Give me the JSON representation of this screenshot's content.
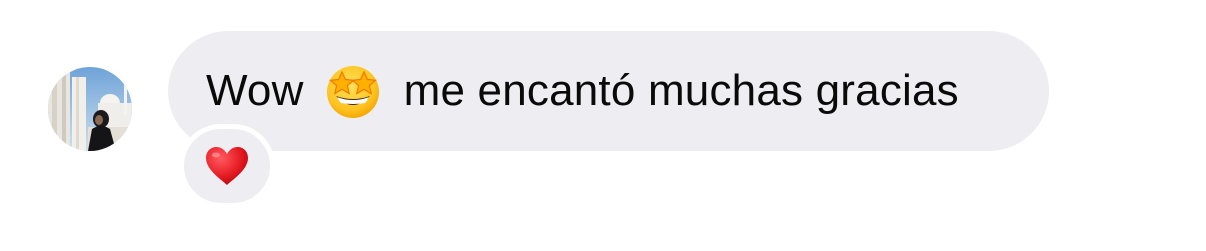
{
  "message": {
    "text_before": "Wow",
    "emoji_inline": "star-struck-emoji",
    "text_after": "me encantó muchas gracias"
  },
  "avatar": {
    "icon": "profile-photo"
  },
  "reaction": {
    "icon": "red-heart-emoji",
    "color": "#e0171f"
  },
  "colors": {
    "bubble": "#eeeef2",
    "text": "#0a0a0a",
    "background": "#ffffff"
  }
}
